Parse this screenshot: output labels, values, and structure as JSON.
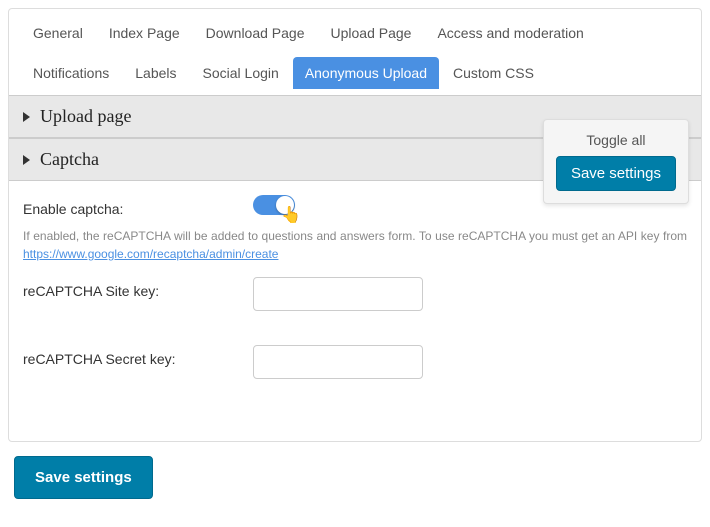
{
  "tabs": {
    "general": "General",
    "index": "Index Page",
    "download": "Download Page",
    "upload": "Upload Page",
    "access": "Access and moderation",
    "notifications": "Notifications",
    "labels": "Labels",
    "social": "Social Login",
    "anonymous": "Anonymous Upload",
    "css": "Custom CSS"
  },
  "sections": {
    "upload_page": "Upload page",
    "captcha": "Captcha"
  },
  "floatbox": {
    "toggle_all": "Toggle all",
    "save": "Save settings"
  },
  "form": {
    "enable_captcha_label": "Enable captcha:",
    "help_text": "If enabled, the reCAPTCHA will be added to questions and answers form. To use reCAPTCHA you must get an API key from ",
    "help_link_text": "https://www.google.com/recaptcha/admin/create",
    "site_key_label": "reCAPTCHA Site key:",
    "secret_key_label": "reCAPTCHA Secret key:",
    "site_key_value": "",
    "secret_key_value": ""
  },
  "bottom": {
    "save": "Save settings"
  }
}
